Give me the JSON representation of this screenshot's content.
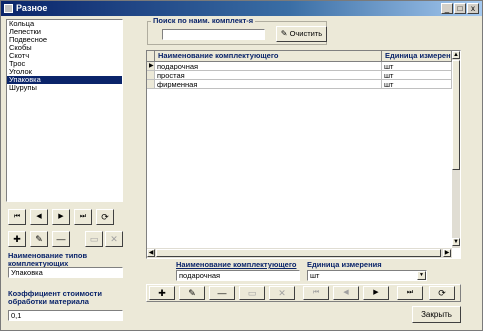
{
  "window": {
    "title": "Разное",
    "minimize": "_",
    "maximize": "□",
    "close": "x"
  },
  "types_list": {
    "items": [
      "Кольца",
      "Лепестки",
      "Подвесное",
      "Скобы",
      "Скотч",
      "Трос",
      "Уголок",
      "Упаковка",
      "Шурупы"
    ],
    "selected_index": 7
  },
  "left_nav": {
    "first": "⏮",
    "prev": "◀",
    "next": "▶",
    "last": "⏭",
    "refresh": "⟳"
  },
  "left_edit": {
    "add": "✚",
    "edit": "✎",
    "delete": "—",
    "save": "▭",
    "cancel": "✕"
  },
  "type_name": {
    "label": "Наименование типов комплектующих",
    "value": "Упаковка"
  },
  "coef": {
    "label": "Коэффициент стоимости обработки материала",
    "value": "0,1"
  },
  "search": {
    "label": "Поиск по наим. комплект-я",
    "value": "",
    "clear_label": "Очистить"
  },
  "table": {
    "columns": [
      "Наименование комплектующего",
      "Единица измерения"
    ],
    "rows": [
      {
        "name": "подарочная",
        "unit": "шт"
      },
      {
        "name": "простая",
        "unit": "шт"
      },
      {
        "name": "фирменная",
        "unit": "шт"
      }
    ],
    "current_row": 0
  },
  "detail": {
    "name_label": "Наименование комплектующего",
    "name_value": "подарочная",
    "unit_label": "Единица измерения",
    "unit_value": "шт"
  },
  "bottom_toolbar": {
    "add": "✚",
    "edit": "✎",
    "delete": "—",
    "save": "▭",
    "cancel": "✕",
    "first": "⏮",
    "prev": "◀",
    "next": "▶",
    "last": "⏭",
    "refresh": "⟳"
  },
  "close_button": "Закрыть",
  "colors": {
    "title_start": "#0a246a",
    "title_end": "#a6caf0",
    "label": "#0a246a",
    "selection": "#0a246a"
  }
}
